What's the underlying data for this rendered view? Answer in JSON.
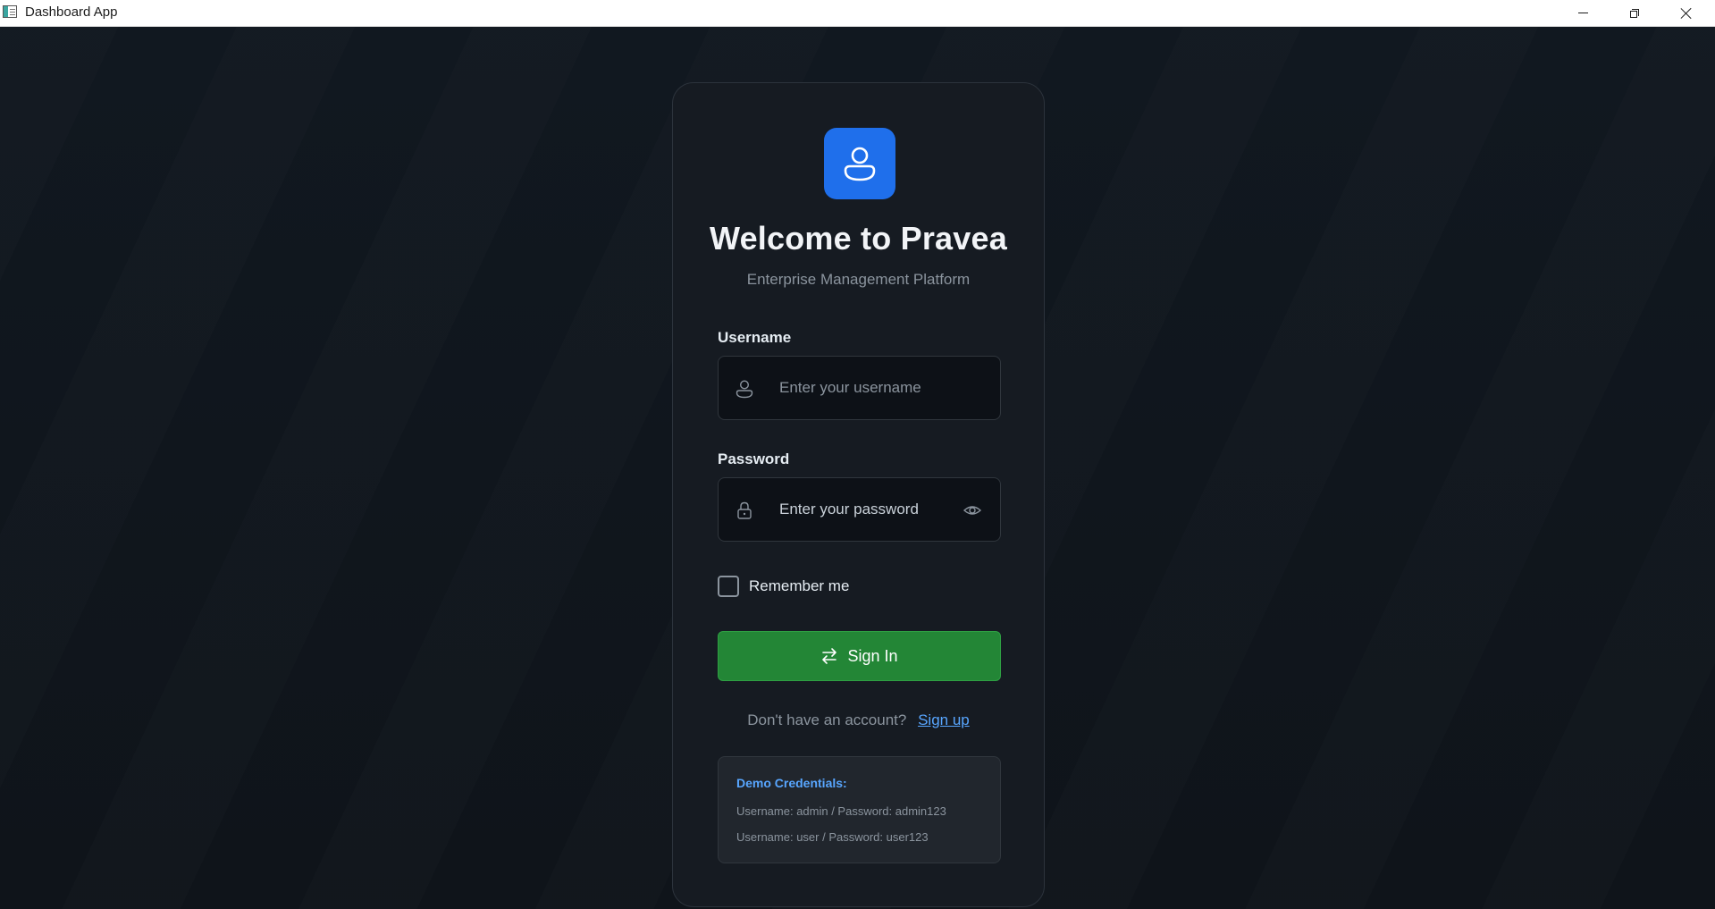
{
  "window": {
    "title": "Dashboard App"
  },
  "login": {
    "heading": "Welcome to Pravea",
    "subheading": "Enterprise Management Platform",
    "username": {
      "label": "Username",
      "placeholder": "Enter your username",
      "value": ""
    },
    "password": {
      "label": "Password",
      "placeholder": "Enter your password",
      "value": ""
    },
    "remember_label": "Remember me",
    "remember_checked": false,
    "signin_label": "Sign In",
    "signup_prompt": "Don't have an account?",
    "signup_link": "Sign up"
  },
  "demo": {
    "title": "Demo Credentials:",
    "lines": [
      "Username: admin / Password: admin123",
      "Username: user / Password: user123"
    ]
  },
  "icons": {
    "logo": "user-icon",
    "username_field": "user-icon",
    "password_field": "lock-icon",
    "password_toggle": "eye-icon",
    "signin": "arrows-exchange-icon"
  },
  "colors": {
    "background": "#0f141b",
    "card": "#161b22",
    "accent_blue": "#1f6feb",
    "primary_green": "#238636",
    "link": "#58a6ff"
  }
}
